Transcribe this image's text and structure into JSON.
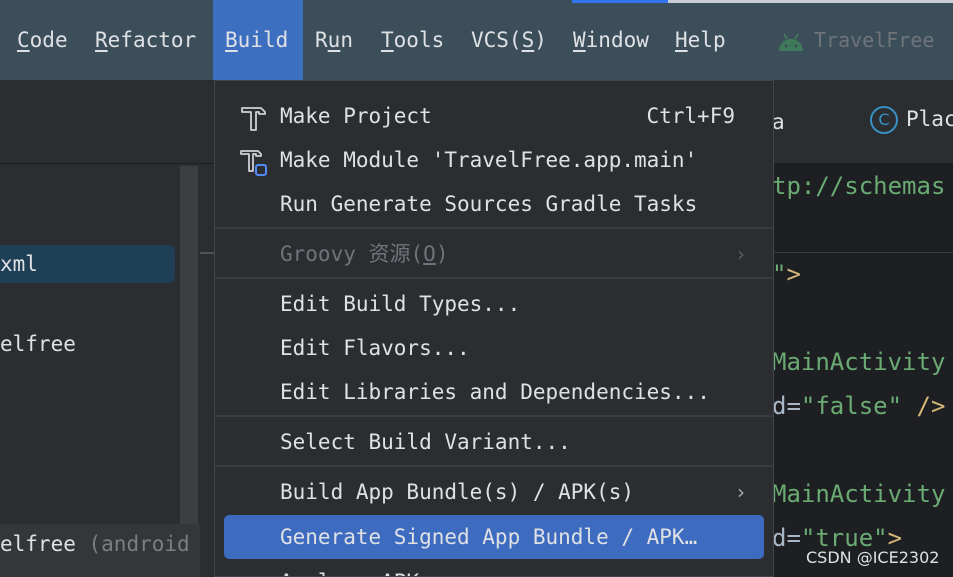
{
  "menubar": {
    "items": [
      {
        "pre": "",
        "u": "C",
        "post": "ode"
      },
      {
        "pre": "",
        "u": "R",
        "post": "efactor"
      },
      {
        "pre": "",
        "u": "B",
        "post": "uild"
      },
      {
        "pre": "R",
        "u": "u",
        "post": "n"
      },
      {
        "pre": "",
        "u": "T",
        "post": "ools"
      },
      {
        "pre": "VCS(",
        "u": "S",
        "post": ")"
      },
      {
        "pre": "",
        "u": "W",
        "post": "indow"
      },
      {
        "pre": "",
        "u": "H",
        "post": "elp"
      }
    ],
    "app_title": "TravelFree",
    "app_icon": "android-icon"
  },
  "project_panel": {
    "item1": "xml",
    "item2": "elfree",
    "item3": "elfree",
    "item3_sub": "(android"
  },
  "editor": {
    "tab1": "a",
    "tab2_icon": "C",
    "tab2": "Plac",
    "lines": {
      "l1": "tp://schemas",
      "l2_attr": "\"",
      "l2_tag": ">",
      "l3": "MainActivity",
      "l4_attr": "d=",
      "l4_val": "\"false\"",
      "l4_tag": " />",
      "l5": "MainActivity",
      "l6_attr": "d=",
      "l6_val": "\"true\"",
      "l6_tag": ">"
    }
  },
  "watermark": "CSDN @ICE2302",
  "build_menu": {
    "make_project": {
      "label": "Make Project",
      "shortcut": "Ctrl+F9",
      "icon": "hammer-icon"
    },
    "make_module": {
      "label": "Make Module 'TravelFree.app.main'",
      "icon": "hammer-module-icon"
    },
    "run_generate": {
      "label": "Run Generate Sources Gradle Tasks"
    },
    "groovy": {
      "pre": "Groovy 资源(",
      "u": "O",
      "post": ")"
    },
    "edit_build_types": {
      "label": "Edit Build Types..."
    },
    "edit_flavors": {
      "label": "Edit Flavors..."
    },
    "edit_libraries": {
      "label": "Edit Libraries and Dependencies..."
    },
    "select_variant": {
      "label": "Select Build Variant..."
    },
    "build_bundle": {
      "label": "Build App Bundle(s) / APK(s)"
    },
    "generate_signed": {
      "label": "Generate Signed App Bundle / APK…"
    },
    "analyze_apk": {
      "label": "Analyze APK..."
    }
  },
  "colors": {
    "menubar_bg": "#3b4e59",
    "active_menu": "#3d6fc0",
    "highlight": "#3d6bbf",
    "menu_bg": "#2b2d30"
  }
}
